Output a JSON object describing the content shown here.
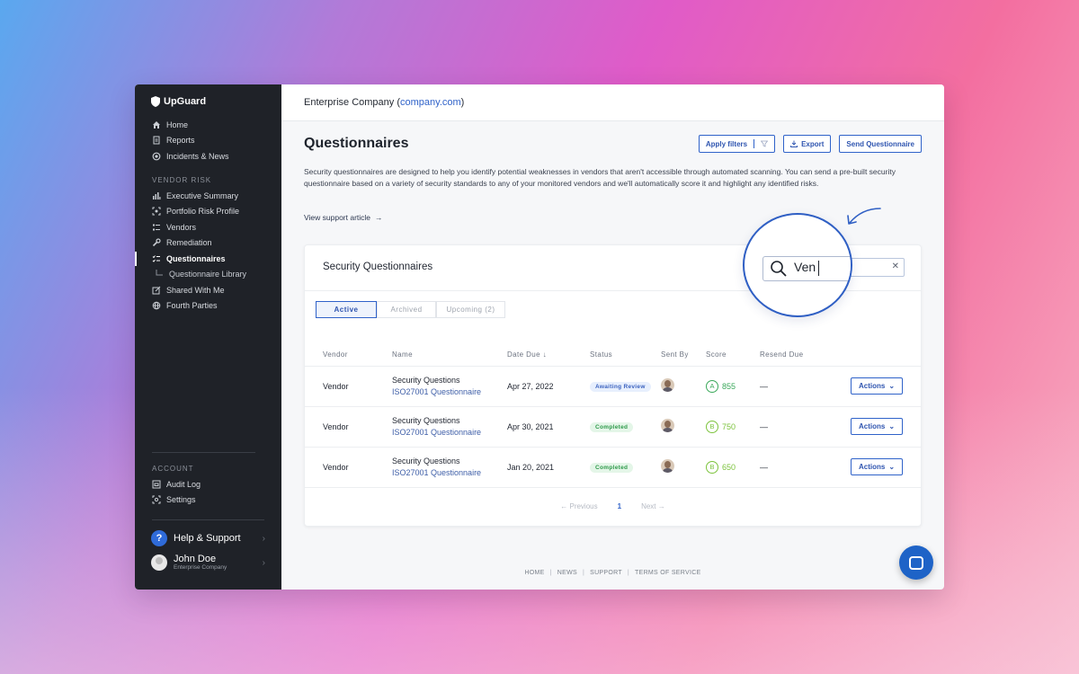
{
  "brand": "UpGuard",
  "sidebar": {
    "items": [
      {
        "label": "Home",
        "icon": "home-icon"
      },
      {
        "label": "Reports",
        "icon": "reports-icon"
      },
      {
        "label": "Incidents & News",
        "icon": "news-icon"
      }
    ],
    "vendor_section": "VENDOR RISK",
    "vendor_items": [
      {
        "label": "Executive Summary",
        "icon": "chart-icon"
      },
      {
        "label": "Portfolio Risk Profile",
        "icon": "profile-icon"
      },
      {
        "label": "Vendors",
        "icon": "vendors-icon"
      },
      {
        "label": "Remediation",
        "icon": "wrench-icon"
      },
      {
        "label": "Questionnaires",
        "icon": "questionnaire-icon"
      },
      {
        "label": "Questionnaire Library",
        "icon": ""
      },
      {
        "label": "Shared With Me",
        "icon": "shared-icon"
      },
      {
        "label": "Fourth Parties",
        "icon": "globe-icon"
      }
    ],
    "account_section": "ACCOUNT",
    "account_items": [
      {
        "label": "Audit Log",
        "icon": "log-icon"
      },
      {
        "label": "Settings",
        "icon": "settings-icon"
      }
    ],
    "help": "Help & Support",
    "user": {
      "name": "John Doe",
      "company": "Enterprise Company"
    }
  },
  "topbar": {
    "company": "Enterprise Company",
    "domain": "company.com"
  },
  "page": {
    "title": "Questionnaires",
    "apply_filters": "Apply filters",
    "export": "Export",
    "send": "Send Questionnaire",
    "description": "Security questionnaires are designed to help you identify potential weaknesses in vendors that aren't accessible through automated scanning. You can send a pre-built security questionnaire based on a variety of security standards to any of your monitored vendors and we'll automatically score it and highlight any identified risks.",
    "support_link": "View support article"
  },
  "card": {
    "title": "Security Questionnaires",
    "search_value": "Ven",
    "tabs": [
      "Active",
      "Archived",
      "Upcoming (2)"
    ],
    "columns": [
      "Vendor",
      "Name",
      "Date Due",
      "Status",
      "Sent By",
      "Score",
      "Resend Due"
    ],
    "rows": [
      {
        "vendor": "Vendor",
        "name": "Security Questions",
        "type": "ISO27001 Questionnaire",
        "date": "Apr 27, 2022",
        "status": "Awaiting Review",
        "grade": "A",
        "score": "855",
        "resend": "—",
        "action": "Actions"
      },
      {
        "vendor": "Vendor",
        "name": "Security Questions",
        "type": "ISO27001 Questionnaire",
        "date": "Apr 30, 2021",
        "status": "Completed",
        "grade": "B",
        "score": "750",
        "resend": "—",
        "action": "Actions"
      },
      {
        "vendor": "Vendor",
        "name": "Security Questions",
        "type": "ISO27001 Questionnaire",
        "date": "Jan 20, 2021",
        "status": "Completed",
        "grade": "B",
        "score": "650",
        "resend": "—",
        "action": "Actions"
      }
    ],
    "pager": {
      "prev": "Previous",
      "page": "1",
      "next": "Next"
    }
  },
  "footer": [
    "HOME",
    "NEWS",
    "SUPPORT",
    "TERMS OF SERVICE"
  ],
  "colors": {
    "accent": "#2f62c9",
    "sidebar_bg": "#1f2228",
    "grade_a": "#3aa85a",
    "grade_b": "#7cc33c"
  }
}
